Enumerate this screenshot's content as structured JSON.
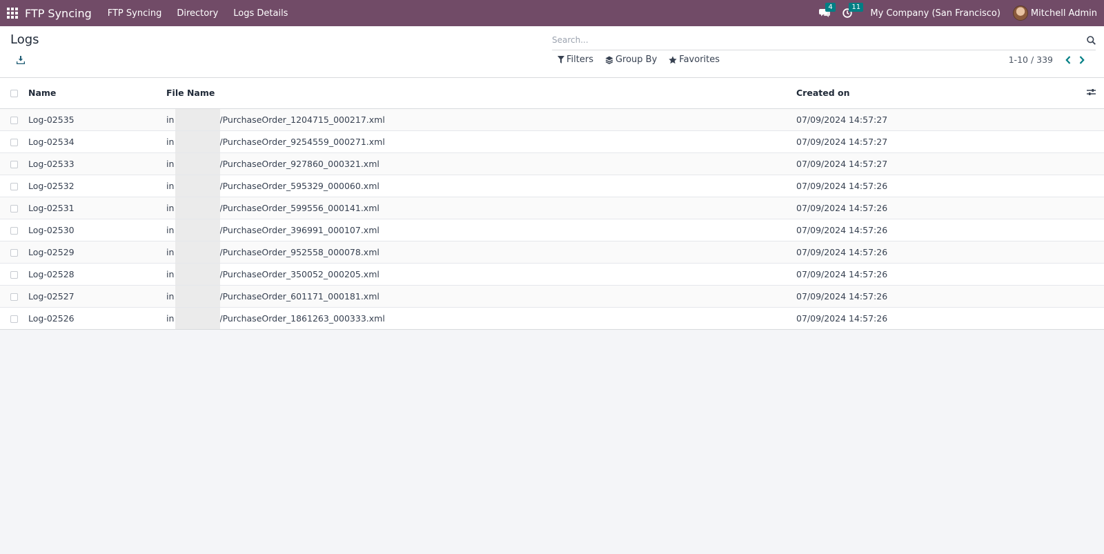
{
  "nav": {
    "brand": "FTP Syncing",
    "menu": [
      "FTP Syncing",
      "Directory",
      "Logs Details"
    ],
    "messages_count": "4",
    "activities_count": "11",
    "company": "My Company (San Francisco)",
    "user": "Mitchell Admin"
  },
  "control": {
    "title": "Logs",
    "search_placeholder": "Search...",
    "filters_label": "Filters",
    "groupby_label": "Group By",
    "favorites_label": "Favorites",
    "pager": "1-10 / 339"
  },
  "table": {
    "columns": [
      "Name",
      "File Name",
      "Created on"
    ],
    "rows": [
      {
        "name": "Log-02535",
        "file_prefix": "in",
        "file_rest": "/PurchaseOrder_1204715_000217.xml",
        "created": "07/09/2024 14:57:27"
      },
      {
        "name": "Log-02534",
        "file_prefix": "in",
        "file_rest": "/PurchaseOrder_9254559_000271.xml",
        "created": "07/09/2024 14:57:27"
      },
      {
        "name": "Log-02533",
        "file_prefix": "in",
        "file_rest": "/PurchaseOrder_927860_000321.xml",
        "created": "07/09/2024 14:57:27"
      },
      {
        "name": "Log-02532",
        "file_prefix": "in",
        "file_rest": "/PurchaseOrder_595329_000060.xml",
        "created": "07/09/2024 14:57:26"
      },
      {
        "name": "Log-02531",
        "file_prefix": "in",
        "file_rest": "/PurchaseOrder_599556_000141.xml",
        "created": "07/09/2024 14:57:26"
      },
      {
        "name": "Log-02530",
        "file_prefix": "in",
        "file_rest": "/PurchaseOrder_396991_000107.xml",
        "created": "07/09/2024 14:57:26"
      },
      {
        "name": "Log-02529",
        "file_prefix": "in",
        "file_rest": "/PurchaseOrder_952558_000078.xml",
        "created": "07/09/2024 14:57:26"
      },
      {
        "name": "Log-02528",
        "file_prefix": "in",
        "file_rest": "/PurchaseOrder_350052_000205.xml",
        "created": "07/09/2024 14:57:26"
      },
      {
        "name": "Log-02527",
        "file_prefix": "in",
        "file_rest": "/PurchaseOrder_601171_000181.xml",
        "created": "07/09/2024 14:57:26"
      },
      {
        "name": "Log-02526",
        "file_prefix": "in",
        "file_rest": "/PurchaseOrder_1861263_000333.xml",
        "created": "07/09/2024 14:57:26"
      }
    ]
  },
  "icons": {
    "apps": "apps-grid-icon",
    "messages": "chat-icon",
    "activities": "clock-icon",
    "export": "download-icon",
    "search": "search-icon",
    "filters": "filter-icon",
    "groupby": "layers-icon",
    "favorites": "star-icon",
    "prev": "chevron-left-icon",
    "next": "chevron-right-icon",
    "optional_columns": "sliders-icon"
  },
  "colors": {
    "navbar": "#714b67",
    "badge": "#017e84",
    "pager_arrows": "#017e84"
  }
}
